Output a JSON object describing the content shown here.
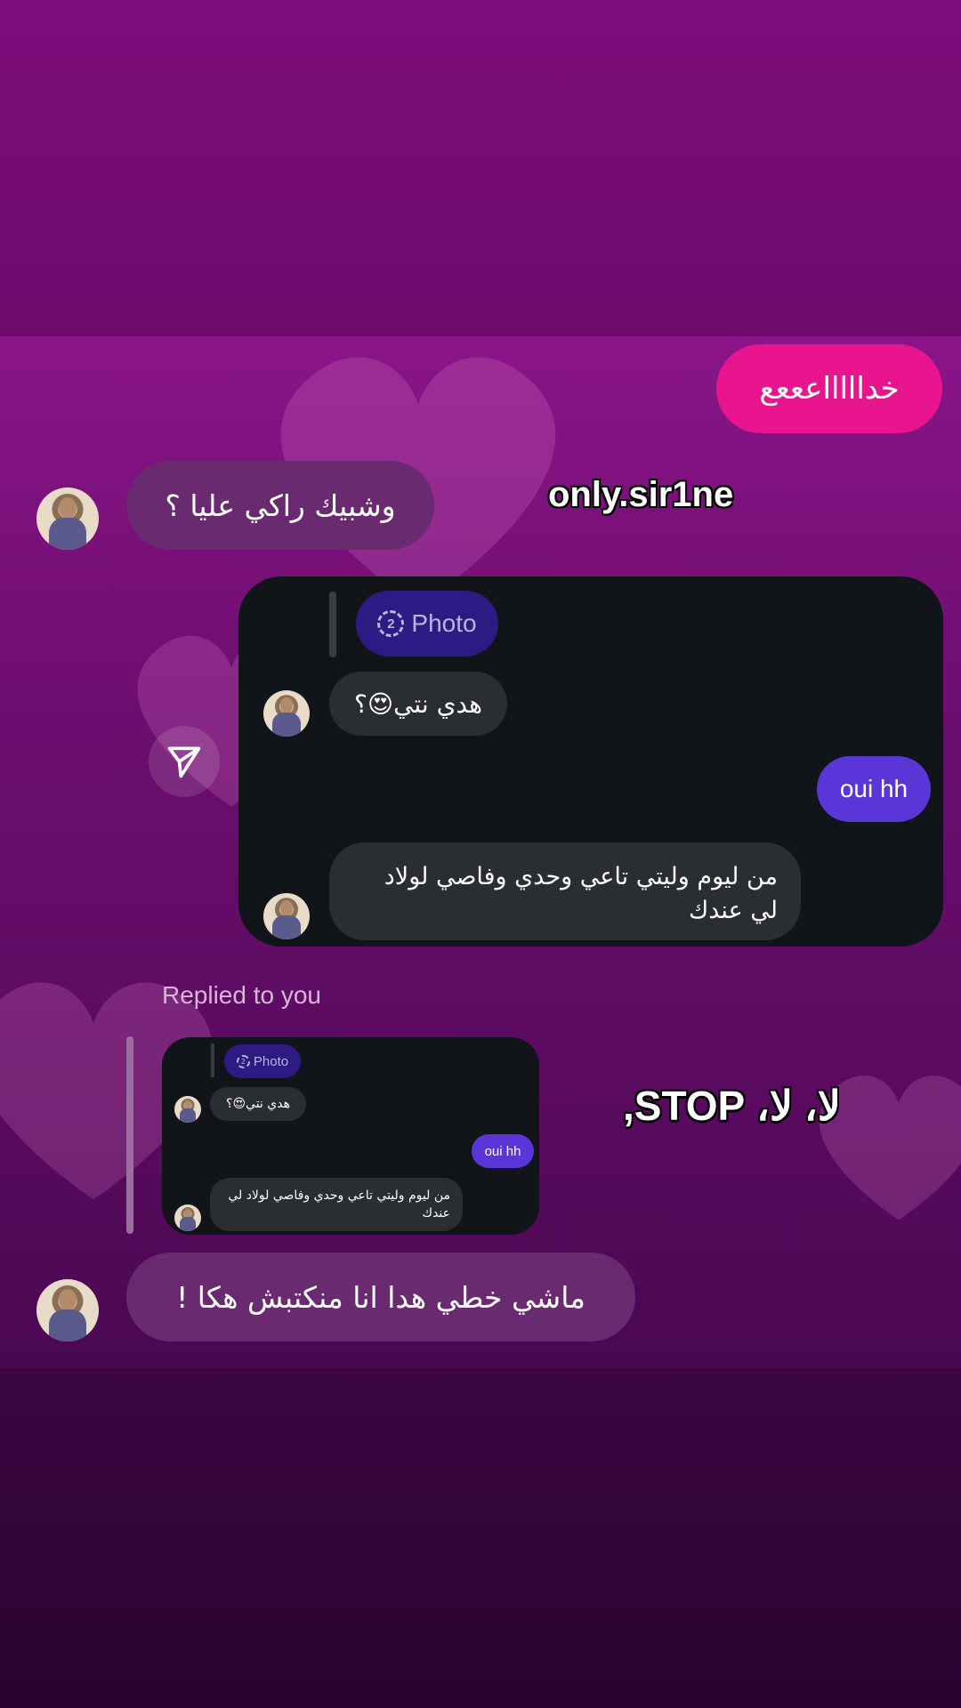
{
  "watermark": "only.sir1ne",
  "overlay_caption": "لا، لا، STOP,",
  "messages": {
    "outgoing_pink": "خداااااعععع",
    "incoming_1": "وشبيك راكي عليا ؟",
    "incoming_2": "ماشي خطي هدا انا منكتبش هكا !"
  },
  "shared_card": {
    "photo_label": "Photo",
    "photo_count": "2",
    "message_1": "هدي نتي😍؟",
    "reply_out": "oui hh",
    "message_2": "من ليوم وليتي تاعي وحدي وفاصي لولاد لي عندك"
  },
  "reply_section": {
    "label": "Replied to you",
    "photo_label": "Photo",
    "photo_count": "2",
    "message_1": "هدي نتي😍؟",
    "reply_out": "oui hh",
    "message_2": "من ليوم وليتي تاعي وحدي وفاصي لولاد لي عندك"
  },
  "colors": {
    "pink_bubble": "#e8158f",
    "incoming_bubble": "#6a2a6f",
    "card_bg": "#111418",
    "outgoing_purple": "#5a36d8",
    "photo_chip": "#2d1a82"
  },
  "icons": {
    "share": "send-arrow-icon",
    "photo": "photo-count-icon"
  }
}
